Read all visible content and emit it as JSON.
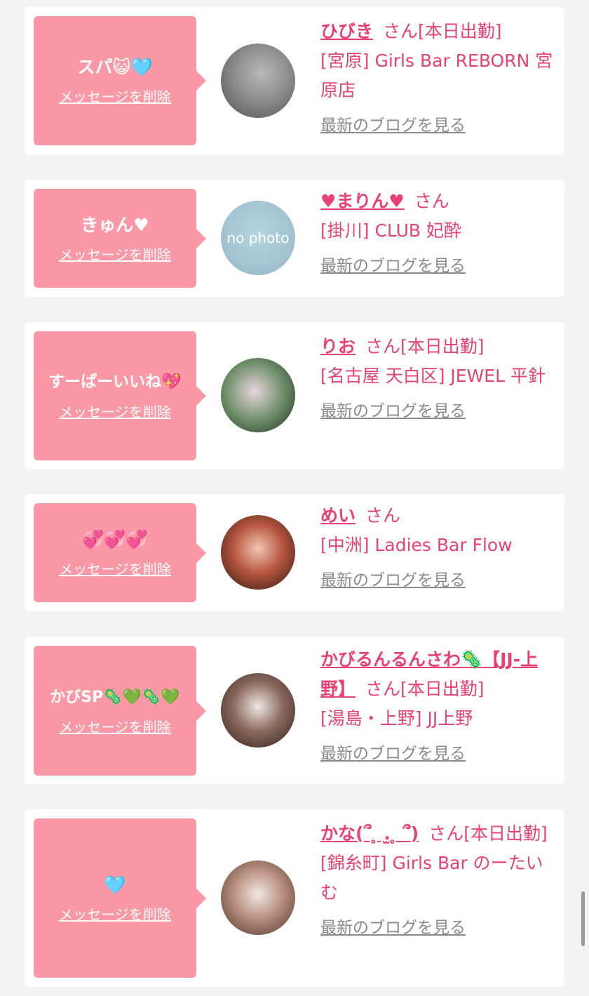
{
  "delete_label": "メッセージを削除",
  "blog_label": "最新のブログを見る",
  "san_label": "さん",
  "colors": {
    "bubble": "#fa98a5",
    "accent": "#e84172",
    "link_gray": "#8a8a8a",
    "background": "#f3f3f3"
  },
  "cards": [
    {
      "message": "スパ😺🩵",
      "name": "ひびき",
      "status": "[本日出勤]",
      "shop": "[宮原] Girls Bar REBORN 宮原店",
      "avatar": "photo-avatar"
    },
    {
      "message": "きゅん♥",
      "name": "♥まりん♥",
      "status": "",
      "shop": "[掛川] CLUB 妃酔",
      "avatar": "no-photo-avatar",
      "avatar_text": "no photo"
    },
    {
      "message": "すーぱーいいね💖",
      "name": "りお",
      "status": "[本日出勤]",
      "shop": "[名古屋 天白区] JEWEL 平針",
      "avatar": "photo-avatar"
    },
    {
      "message": "💞💞💞",
      "name": "めい",
      "status": "",
      "shop": "[中洲] Ladies Bar Flow",
      "avatar": "photo-avatar"
    },
    {
      "message": "かびSP🦠💚🦠💚",
      "name": "かびるんるんさわ🦠【JJ-上野】",
      "status": "[本日出勤]",
      "shop": "[湯島・上野] JJ上野",
      "avatar": "photo-avatar"
    },
    {
      "message": "🩵",
      "name": "かな(՞ ̥ .̫ ̥ ՞)",
      "status": "[本日出勤]",
      "shop": "[錦糸町] Girls Bar のーたいむ",
      "avatar": "photo-avatar"
    }
  ]
}
